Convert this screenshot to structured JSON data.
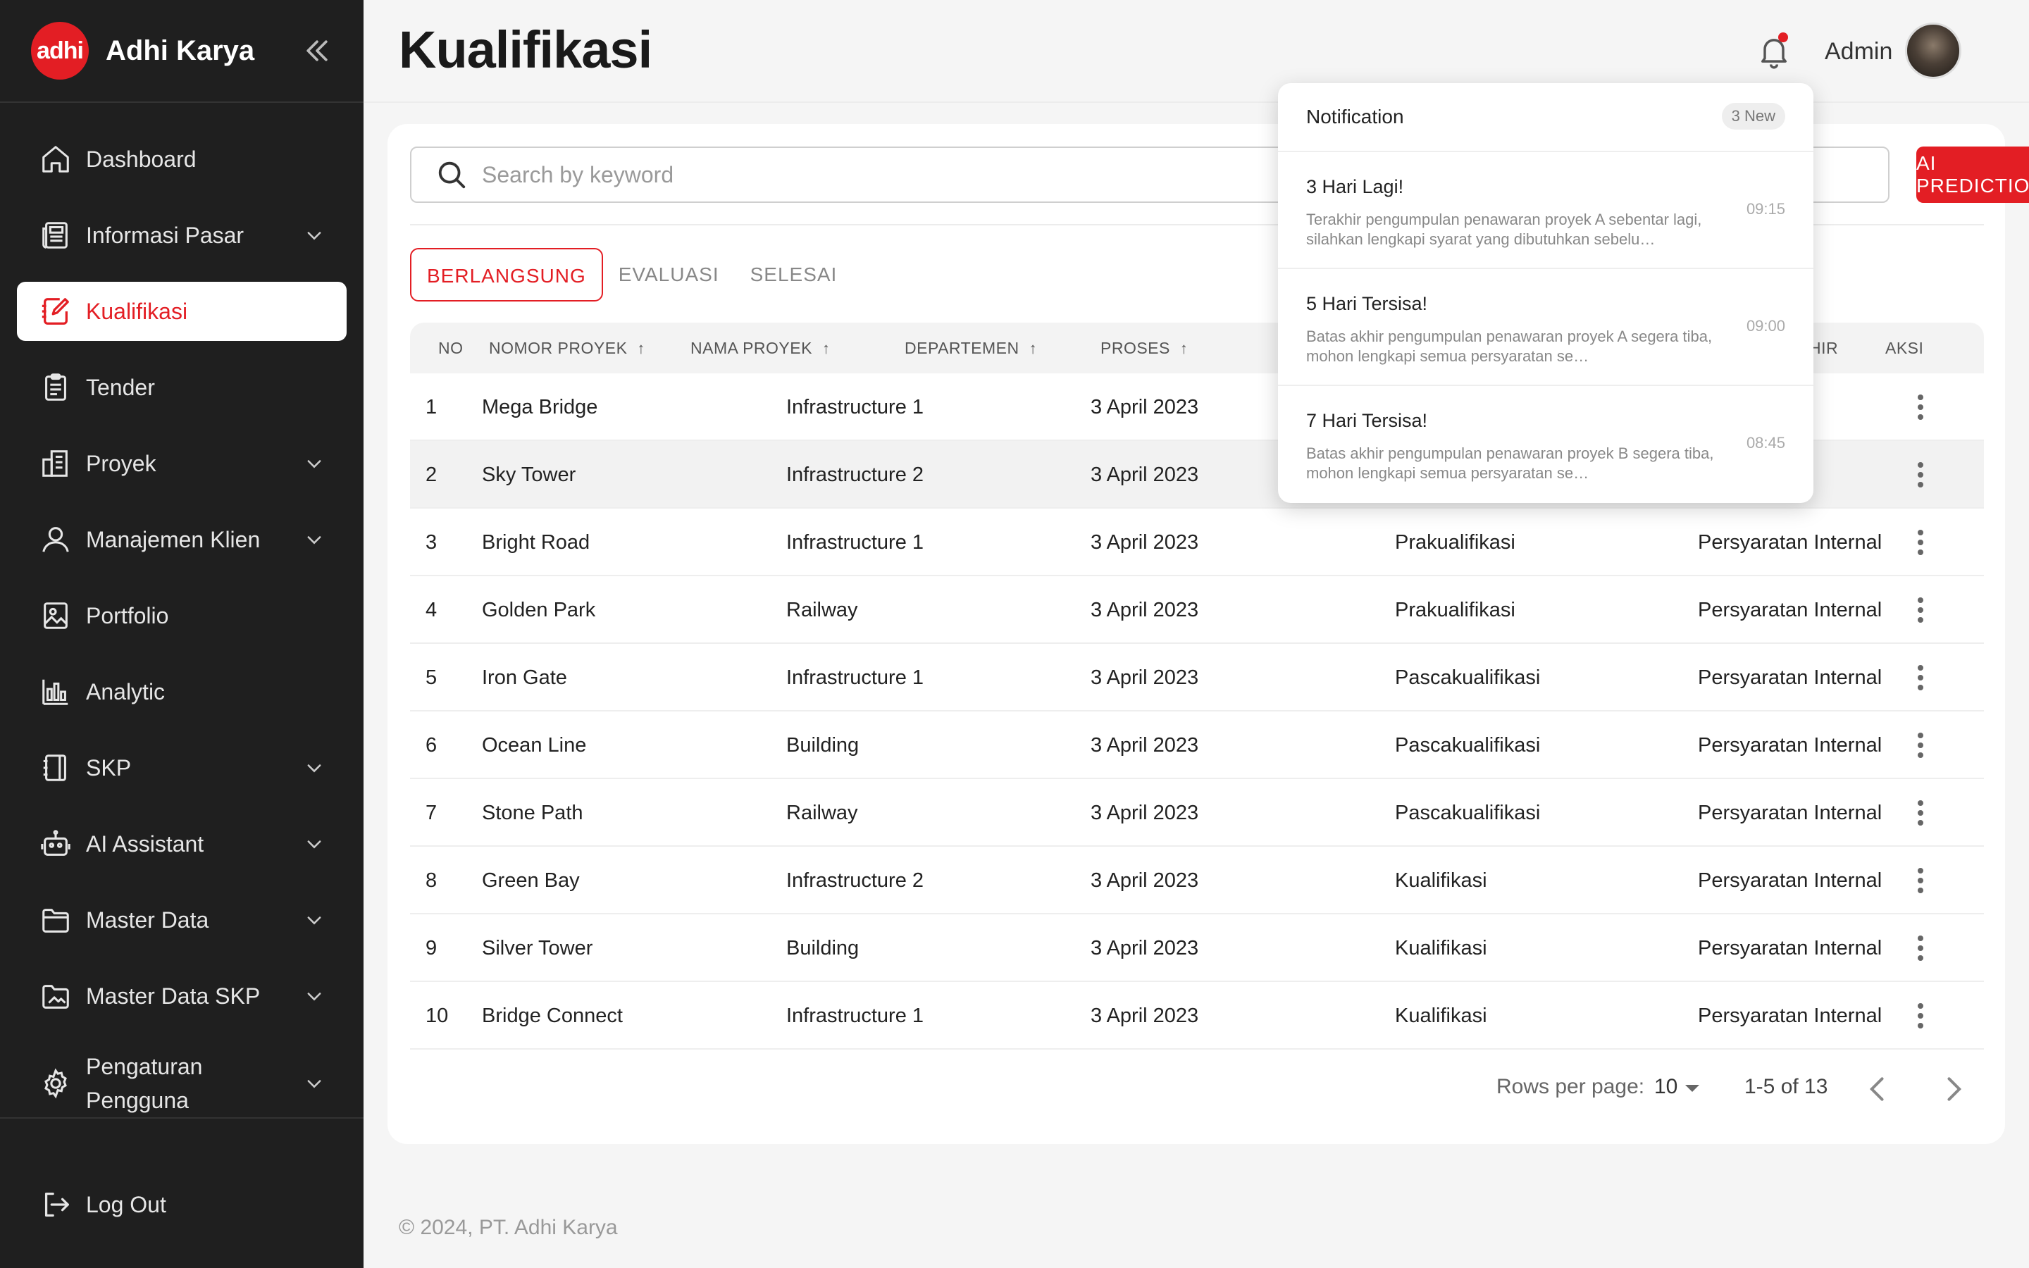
{
  "brand": {
    "logo_text": "adhi",
    "name": "Adhi Karya"
  },
  "sidebar": {
    "items": [
      {
        "label": "Dashboard",
        "icon": "home-icon",
        "has_children": false
      },
      {
        "label": "Informasi Pasar",
        "icon": "newspaper-icon",
        "has_children": true
      },
      {
        "label": "Kualifikasi",
        "icon": "edit-note-icon",
        "has_children": false,
        "active": true
      },
      {
        "label": "Tender",
        "icon": "clipboard-list-icon",
        "has_children": false
      },
      {
        "label": "Proyek",
        "icon": "building-icon",
        "has_children": true
      },
      {
        "label": "Manajemen Klien",
        "icon": "user-icon",
        "has_children": true
      },
      {
        "label": "Portfolio",
        "icon": "image-icon",
        "has_children": false
      },
      {
        "label": "Analytic",
        "icon": "bar-chart-icon",
        "has_children": false
      },
      {
        "label": "SKP",
        "icon": "notebook-icon",
        "has_children": true
      },
      {
        "label": "AI Assistant",
        "icon": "robot-icon",
        "has_children": true
      },
      {
        "label": "Master Data",
        "icon": "folder-icon",
        "has_children": true
      },
      {
        "label": "Master Data SKP",
        "icon": "folder-image-icon",
        "has_children": true
      },
      {
        "label": "Pengaturan Pengguna",
        "icon": "gear-icon",
        "has_children": true
      }
    ],
    "logout_label": "Log Out"
  },
  "header": {
    "title": "Kualifikasi",
    "user_name": "Admin"
  },
  "search": {
    "placeholder": "Search by keyword"
  },
  "ai_button_label": "AI PREDICTION",
  "tabs": [
    {
      "label": "BERLANGSUNG",
      "active": true
    },
    {
      "label": "EVALUASI",
      "active": false
    },
    {
      "label": "SELESAI",
      "active": false
    }
  ],
  "table": {
    "columns": [
      "NO",
      "NOMOR PROYEK",
      "NAMA PROYEK",
      "DEPARTEMEN",
      "PROSES",
      "HIR",
      "AKSI"
    ],
    "rows": [
      {
        "no": "1",
        "nomor": "Mega Bridge",
        "nama": "Infrastructure 1",
        "dept": "3 April 2023",
        "proses": "",
        "extra": ""
      },
      {
        "no": "2",
        "nomor": "Sky Tower",
        "nama": "Infrastructure 2",
        "dept": "3 April 2023",
        "proses": "",
        "extra": ""
      },
      {
        "no": "3",
        "nomor": "Bright Road",
        "nama": "Infrastructure 1",
        "dept": "3 April 2023",
        "proses": "Prakualifikasi",
        "extra": "Persyaratan Internal"
      },
      {
        "no": "4",
        "nomor": "Golden Park",
        "nama": "Railway",
        "dept": "3 April 2023",
        "proses": "Prakualifikasi",
        "extra": "Persyaratan Internal"
      },
      {
        "no": "5",
        "nomor": "Iron Gate",
        "nama": "Infrastructure 1",
        "dept": "3 April 2023",
        "proses": "Pascakualifikasi",
        "extra": "Persyaratan Internal"
      },
      {
        "no": "6",
        "nomor": "Ocean Line",
        "nama": "Building",
        "dept": "3 April 2023",
        "proses": "Pascakualifikasi",
        "extra": "Persyaratan Internal"
      },
      {
        "no": "7",
        "nomor": "Stone Path",
        "nama": "Railway",
        "dept": "3 April 2023",
        "proses": "Pascakualifikasi",
        "extra": "Persyaratan Internal"
      },
      {
        "no": "8",
        "nomor": "Green Bay",
        "nama": "Infrastructure 2",
        "dept": "3 April 2023",
        "proses": "Kualifikasi",
        "extra": "Persyaratan Internal"
      },
      {
        "no": "9",
        "nomor": "Silver Tower",
        "nama": "Building",
        "dept": "3 April 2023",
        "proses": "Kualifikasi",
        "extra": "Persyaratan Internal"
      },
      {
        "no": "10",
        "nomor": "Bridge Connect",
        "nama": "Infrastructure 1",
        "dept": "3 April 2023",
        "proses": "Kualifikasi",
        "extra": "Persyaratan Internal"
      }
    ]
  },
  "pagination": {
    "rows_per_page_label": "Rows per page:",
    "rows_per_page": "10",
    "range": "1-5 of 13"
  },
  "footer": "© 2024, PT. Adhi Karya",
  "notifications": {
    "title": "Notification",
    "badge": "3 New",
    "items": [
      {
        "title": "3 Hari Lagi!",
        "body": "Terakhir pengumpulan penawaran proyek A sebentar lagi, silahkan lengkapi syarat yang dibutuhkan sebelu…",
        "time": "09:15"
      },
      {
        "title": "5 Hari Tersisa!",
        "body": "Batas akhir pengumpulan penawaran proyek A segera tiba, mohon lengkapi semua persyaratan se…",
        "time": "09:00"
      },
      {
        "title": "7 Hari Tersisa!",
        "body": "Batas akhir pengumpulan penawaran proyek B segera tiba, mohon lengkapi semua persyaratan se…",
        "time": "08:45"
      }
    ]
  },
  "colors": {
    "accent": "#e31e24",
    "sidebar_bg": "#1f1f1f",
    "page_bg": "#f5f5f5"
  }
}
